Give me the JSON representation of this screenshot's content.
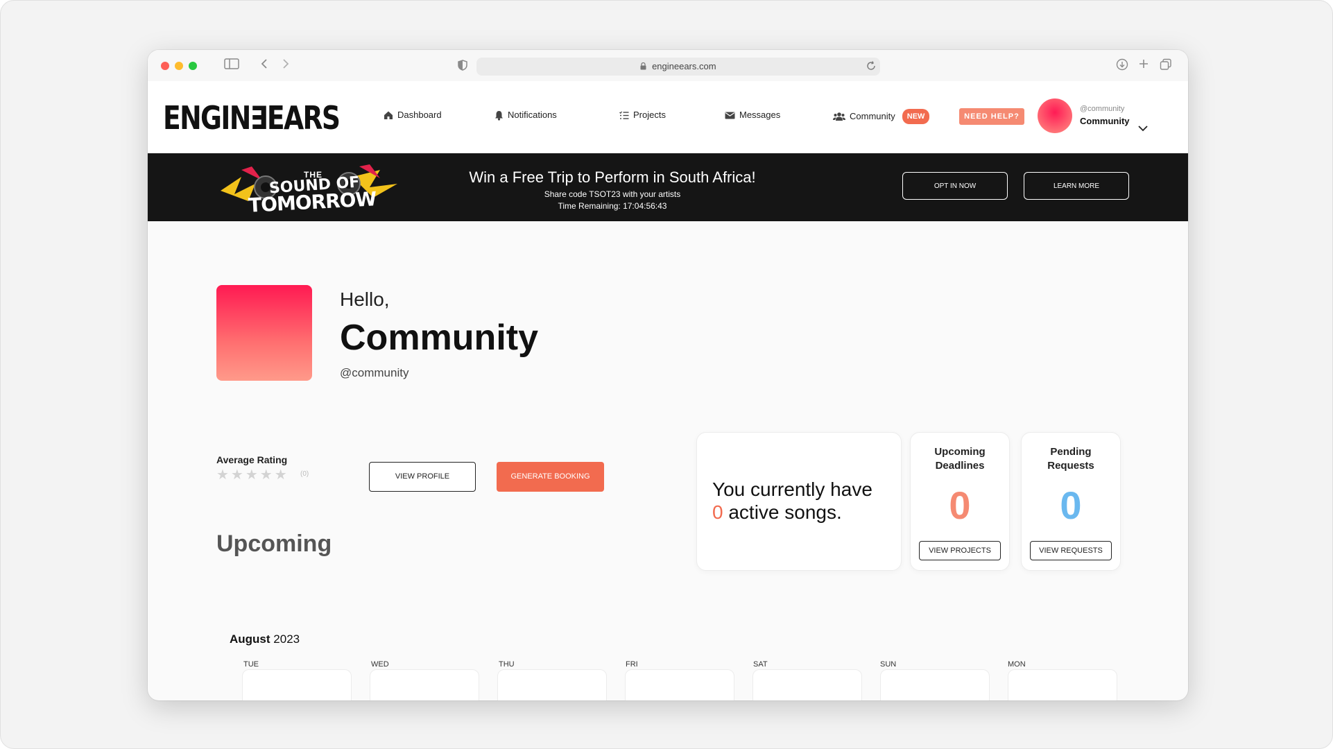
{
  "browser": {
    "url": "engineears.com"
  },
  "nav": {
    "logo": "ENGIN∃EARS",
    "items": [
      {
        "label": "Dashboard",
        "icon": "home-icon"
      },
      {
        "label": "Notifications",
        "icon": "bell-icon"
      },
      {
        "label": "Projects",
        "icon": "list-icon"
      },
      {
        "label": "Messages",
        "icon": "envelope-icon"
      },
      {
        "label": "Community",
        "icon": "users-icon"
      }
    ],
    "community_badge": "NEW",
    "help_label": "NEED HELP?",
    "user_handle": "@community",
    "user_name": "Community"
  },
  "banner": {
    "logo_line1": "THE",
    "logo_line2": "SOUND OF",
    "logo_line3": "TOMORROW",
    "title": "Win a Free Trip to Perform in South Africa!",
    "subtitle": "Share code TSOT23 with your artists",
    "time_remaining": "Time Remaining: 17:04:56:43",
    "opt_in_label": "OPT IN NOW",
    "learn_more_label": "LEARN MORE"
  },
  "profile": {
    "greeting": "Hello,",
    "name": "Community",
    "handle": "@community",
    "rating_label": "Average Rating",
    "rating_stars": "★★★★★",
    "rating_count": "(0)",
    "view_profile_label": "VIEW PROFILE",
    "generate_booking_label": "GENERATE BOOKING",
    "upcoming_title": "Upcoming"
  },
  "stats": {
    "songs_prefix": "You currently have",
    "songs_count": "0",
    "songs_suffix": "active songs.",
    "deadlines_title_1": "Upcoming",
    "deadlines_title_2": "Deadlines",
    "deadlines_count": "0",
    "deadlines_button": "VIEW PROJECTS",
    "requests_title_1": "Pending",
    "requests_title_2": "Requests",
    "requests_count": "0",
    "requests_button": "VIEW REQUESTS"
  },
  "calendar": {
    "month": "August",
    "year": "2023",
    "days": [
      "TUE",
      "WED",
      "THU",
      "FRI",
      "SAT",
      "SUN",
      "MON"
    ]
  },
  "colors": {
    "accent_orange": "#f26b4f",
    "accent_blue": "#6ab8ef",
    "banner_bg": "#151515"
  }
}
